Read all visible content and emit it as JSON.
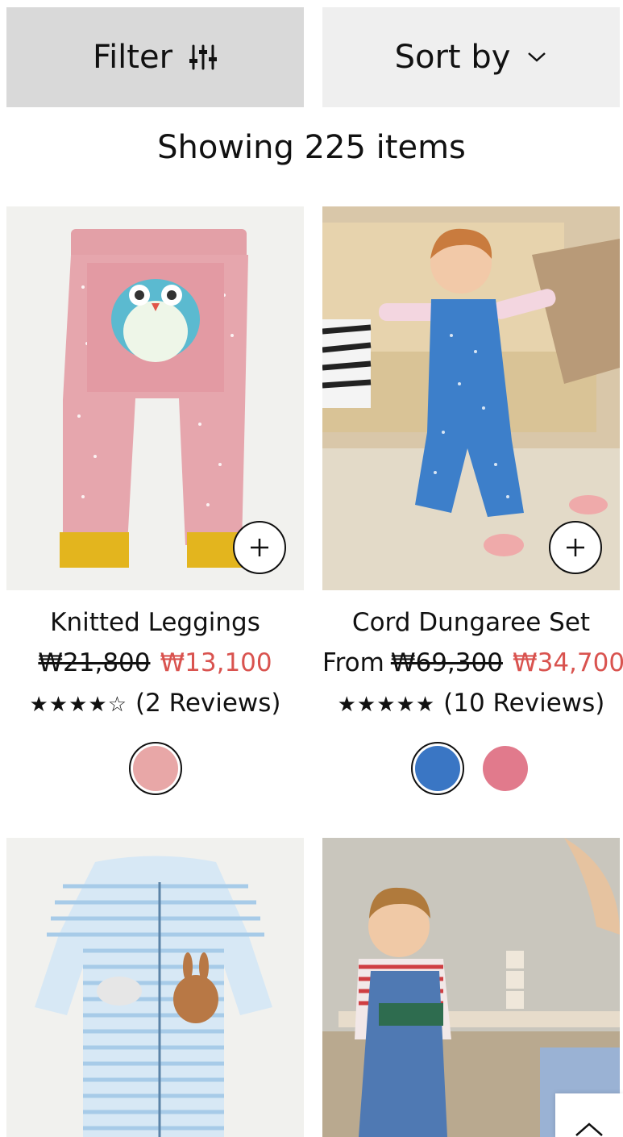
{
  "toolbar": {
    "filter_label": "Filter",
    "sort_label": "Sort by"
  },
  "results": {
    "showing_text": "Showing 225 items"
  },
  "products": [
    {
      "title": "Knitted Leggings",
      "price_prefix": "",
      "old_price": "₩21,800",
      "new_price": "₩13,100",
      "stars": "★★★★☆",
      "rating_value": 4.5,
      "reviews": "(2 Reviews)",
      "swatches": [
        {
          "color": "#e8a7a7",
          "selected": true
        }
      ]
    },
    {
      "title": "Cord Dungaree Set",
      "price_prefix": "From",
      "old_price": "₩69,300",
      "new_price": "₩34,700",
      "stars": "★★★★★",
      "rating_value": 5,
      "reviews": "(10 Reviews)",
      "swatches": [
        {
          "color": "#3a76c4",
          "selected": true
        },
        {
          "color": "#e17a8c",
          "selected": false
        }
      ]
    }
  ],
  "colors": {
    "sale_red": "#d9534f",
    "filter_bg": "#d9d9d9",
    "sort_bg": "#efefef"
  }
}
